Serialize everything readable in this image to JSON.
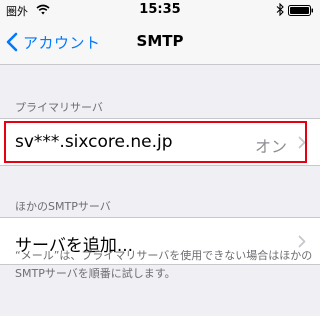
{
  "status_bar": {
    "carrier": "圏外",
    "time": "15:35"
  },
  "nav": {
    "back_label": "アカウント",
    "title": "SMTP"
  },
  "primary_section": {
    "header": "プライマリサーバ",
    "server_name": "sv***.sixcore.ne.jp",
    "status": "オン"
  },
  "other_section": {
    "header": "ほかのSMTPサーバ",
    "add_label": "サーバを追加..."
  },
  "footer_note": "“メール”は、プライマリサーバを使用できない場合はほかのSMTPサーバを順番に試します。",
  "colors": {
    "accent": "#007aff",
    "highlight": "#e60012",
    "background": "#efeff4"
  }
}
